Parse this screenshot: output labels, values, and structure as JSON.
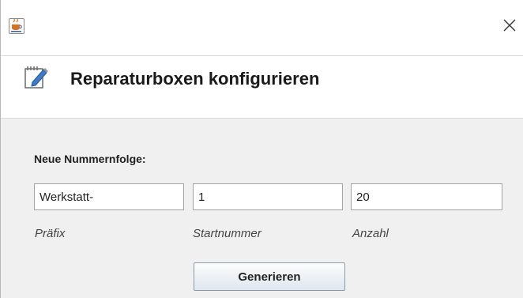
{
  "window": {
    "app_icon": "java-coffee-cup-icon",
    "close_icon": "close-icon"
  },
  "header": {
    "icon": "edit-note-icon",
    "title": "Reparaturboxen konfigurieren"
  },
  "form": {
    "section_label": "Neue Nummernfolge:",
    "prefix": {
      "value": "Werkstatt-",
      "label": "Präfix"
    },
    "start": {
      "value": "1",
      "label": "Startnummer"
    },
    "count": {
      "value": "20",
      "label": "Anzahl"
    },
    "generate_label": "Generieren"
  },
  "colors": {
    "accent": "#d9701f",
    "background": "#f0f0f0"
  }
}
